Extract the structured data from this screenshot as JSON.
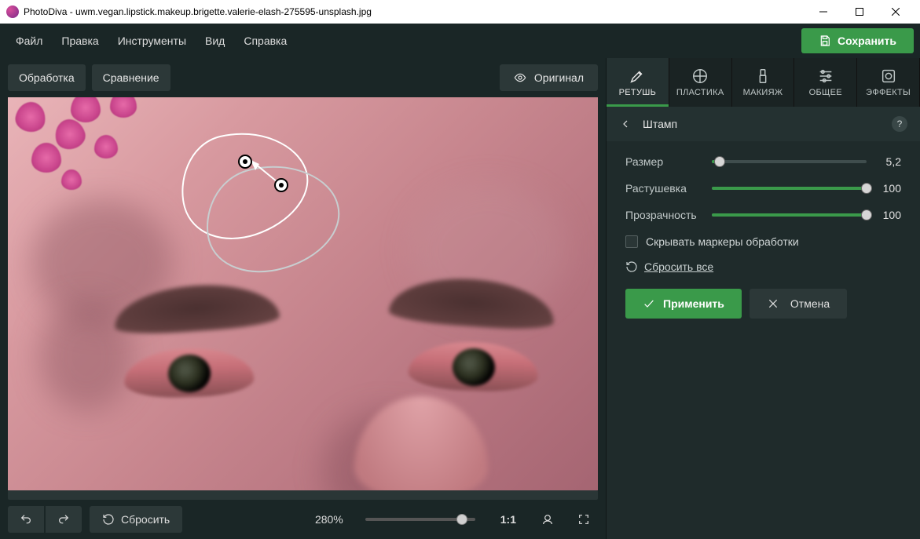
{
  "window": {
    "app": "PhotoDiva",
    "file": "uwm.vegan.lipstick.makeup.brigette.valerie-elash-275595-unsplash.jpg"
  },
  "menu": {
    "file": "Файл",
    "edit": "Правка",
    "tools": "Инструменты",
    "view": "Вид",
    "help": "Справка",
    "save": "Сохранить"
  },
  "toolbar": {
    "process": "Обработка",
    "compare": "Сравнение",
    "original": "Оригинал"
  },
  "bottom": {
    "reset": "Сбросить",
    "zoom": "280%",
    "ratio": "1:1"
  },
  "tabs": {
    "retouch": "РЕТУШЬ",
    "plastic": "ПЛАСТИКА",
    "makeup": "МАКИЯЖ",
    "general": "ОБЩЕЕ",
    "effects": "ЭФФЕКТЫ"
  },
  "panel": {
    "title": "Штамп",
    "help": "?",
    "size_label": "Размер",
    "size_value": "5,2",
    "feather_label": "Растушевка",
    "feather_value": "100",
    "opacity_label": "Прозрачность",
    "opacity_value": "100",
    "hide_markers": "Скрывать маркеры обработки",
    "reset_all": "Сбросить все",
    "apply": "Применить",
    "cancel": "Отмена"
  }
}
